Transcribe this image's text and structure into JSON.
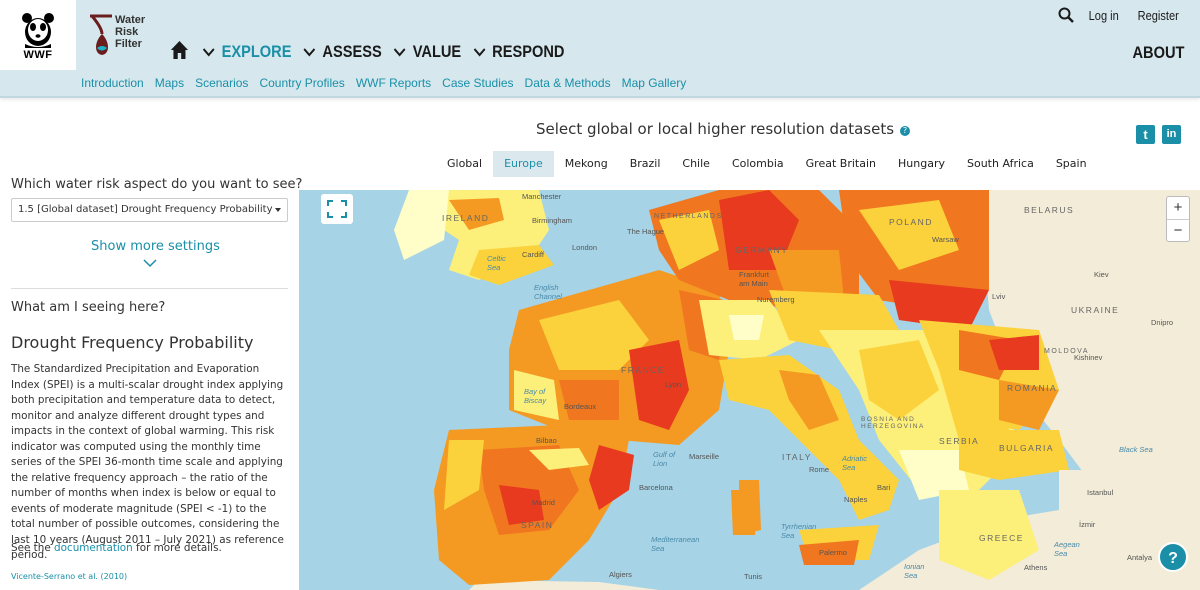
{
  "header": {
    "wwf_logo_text": "WWF",
    "wrf_logo_text": "Water\nRisk\nFilter",
    "nav": [
      {
        "label": "EXPLORE",
        "active": true
      },
      {
        "label": "ASSESS",
        "active": false
      },
      {
        "label": "VALUE",
        "active": false
      },
      {
        "label": "RESPOND",
        "active": false
      }
    ],
    "login": "Log in",
    "register": "Register",
    "about": "ABOUT"
  },
  "subnav": [
    "Introduction",
    "Maps",
    "Scenarios",
    "Country Profiles",
    "WWF Reports",
    "Case Studies",
    "Data & Methods",
    "Map Gallery"
  ],
  "datasets": {
    "title": "Select global or local higher resolution datasets",
    "help": "?",
    "tabs": [
      "Global",
      "Europe",
      "Mekong",
      "Brazil",
      "Chile",
      "Colombia",
      "Great Britain",
      "Hungary",
      "South Africa",
      "Spain"
    ],
    "active_tab": "Europe",
    "twitter": "t",
    "linkedin": "in"
  },
  "left_panel": {
    "question": "Which water risk aspect do you want to see?",
    "selected": "1.5 [Global dataset] Drought Frequency Probability",
    "show_more": "Show more settings",
    "what_seeing": "What am I seeing here?",
    "title": "Drought Frequency Probability",
    "description": "The Standardized Precipitation and Evaporation Index (SPEI) is a multi-scalar drought index applying both precipitation and temperature data to detect, monitor and analyze different drought types and impacts in the context of global warming. This risk indicator was computed using the monthly time series of the SPEI 36-month time scale and applying the relative frequency approach – the ratio of the number of months when index is below or equal to events of moderate magnitude (SPEI < -1) to the total number of possible outcomes, considering the last 10 years (August 2011 – July 2021) as reference period.",
    "docs_prefix": "See the ",
    "docs_link": "documentation",
    "docs_suffix": " for more details.",
    "citation": "Vicente-Serrano et al. (2010)"
  },
  "map": {
    "labels": {
      "manchester": "Manchester",
      "ireland": "IRELAND",
      "birmingham": "Birmingham",
      "cardiff": "Cardiff",
      "london": "London",
      "celtic_sea": "Celtic\nSea",
      "english_channel": "English\nChannel",
      "the_hague": "The Hague",
      "netherlands": "NETHERLANDS",
      "germany": "GERMANY",
      "frankfurt": "Frankfurt\nam Main",
      "nuremberg": "Nuremberg",
      "poland": "POLAND",
      "warsaw": "Warsaw",
      "belarus": "BELARUS",
      "kiev": "Kiev",
      "ukraine": "UKRAINE",
      "lviv": "Lviv",
      "dnipro": "Dnipro",
      "moldova": "MOLDOVA",
      "kishinev": "Kishinev",
      "bay_of_biscay": "Bay of\nBiscay",
      "france": "FRANCE",
      "bordeaux": "Bordeaux",
      "lyon": "Lyon",
      "marseille": "Marseille",
      "bilbao": "Bilbao",
      "gulf_of_lion": "Gulf of\nLion",
      "barcelona": "Barcelona",
      "madrid": "Madrid",
      "spain": "SPAIN",
      "italy": "ITALY",
      "rome": "Rome",
      "bari": "Bari",
      "naples": "Naples",
      "palermo": "Palermo",
      "adriatic": "Adriatic\nSea",
      "tyrrhenian": "Tyrrhenian\nSea",
      "mediterranean": "Mediterranean\nSea",
      "ionian": "Ionian\nSea",
      "romania": "ROMANIA",
      "bosnia": "BOSNIA AND\nHERZEGOVINA",
      "serbia": "SERBIA",
      "bulgaria": "BULGARIA",
      "istanbul": "Istanbul",
      "black_sea": "Black Sea",
      "greece": "GREECE",
      "athens": "Athens",
      "aegean": "Aegean\nSea",
      "tunis": "Tunis",
      "algiers": "Algiers",
      "antalya": "Antalya",
      "izmir": "İzmir"
    },
    "zoom_in": "+",
    "zoom_out": "−",
    "help": "?",
    "colors": {
      "very_high": "#e83a1f",
      "high": "#f0761f",
      "medium_high": "#f49a22",
      "medium": "#fbd23b",
      "low": "#fdf07a",
      "very_low": "#fffec8",
      "water": "#a6d3e6",
      "land_outside": "#f2ecd9"
    }
  }
}
